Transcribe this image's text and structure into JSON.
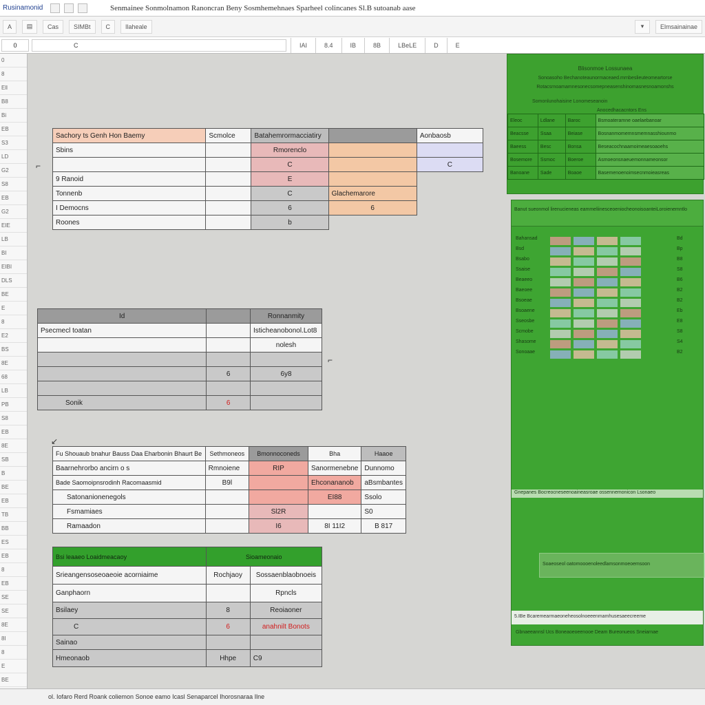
{
  "titlebar": {
    "app_name": "Rusinamonid",
    "title": "Senmainee  Sonmolnamon Ranoncran Beny  Sosmhemehnaes  Sparheel colincanes  Sl.B sutoanab aase"
  },
  "ribbon": {
    "items": [
      "A",
      "Cas",
      "SIMBt",
      "C",
      "Ilaheale"
    ],
    "right_label": "Elmsainainae"
  },
  "formula": {
    "name_box": "0",
    "fx_text": "C",
    "fx_hint": "0",
    "tabs": [
      "IAI",
      "8.4",
      "IB",
      "8B",
      "LBeLE",
      "D",
      "E"
    ]
  },
  "left_panel": {
    "rows": [
      "0",
      "8",
      "Ell",
      "B8",
      "Bi",
      "EB",
      "S3",
      "LD",
      "G2",
      "S8",
      "EB",
      "G2",
      "EIE",
      "LB",
      "BI",
      "EIBI",
      "DLS",
      "BE",
      "E",
      "8",
      "E2",
      "BS",
      "8E",
      "68",
      "LB",
      "PB",
      "S8",
      "EB",
      "8E",
      "SB",
      "B",
      "BE",
      "EB",
      "TB",
      "BB",
      "ES",
      "EB",
      "8",
      "EB",
      "SE",
      "SE",
      "8E",
      "8I",
      "8",
      "E",
      "BE"
    ]
  },
  "table1": {
    "header": [
      "Sachory ts Genh Hon Baemy",
      "Scmolce",
      "Batahemrormacciatiry",
      "",
      "Aonbaosb"
    ],
    "rows": [
      [
        "Sbins",
        "",
        "Rmorenclo",
        "",
        ""
      ],
      [
        "",
        "",
        "C",
        "",
        "C"
      ],
      [
        "9 Ranoid",
        "",
        "E",
        "",
        ""
      ],
      [
        "Tonnenb",
        "",
        "C",
        "Glachemarore",
        ""
      ],
      [
        "I Democns",
        "",
        "6",
        "6",
        ""
      ],
      [
        "Roones",
        "",
        "b",
        "",
        ""
      ]
    ]
  },
  "table2": {
    "header": [
      "Id",
      "",
      "Ronnanmity"
    ],
    "rows": [
      [
        "Psecmecl toatan",
        "",
        "Isticheanobonol.Lot8"
      ],
      [
        "",
        "",
        "nolesh"
      ],
      [
        "",
        "",
        ""
      ],
      [
        "",
        "6",
        "6y8"
      ],
      [
        "",
        "",
        ""
      ],
      [
        "Sonik",
        "6",
        ""
      ]
    ]
  },
  "table3": {
    "header": [
      "Fu Shouaub bnahur Bauss Daa Eharbonin Bhaurt Be",
      "Sethmoneos",
      "Bmonnoconeds",
      "Bha",
      "Haaoe"
    ],
    "rows": [
      [
        "Baarnehrorbo ancirn o s",
        "Rmnoiene",
        "RIP",
        "Sanormenebne",
        "Dunnomo"
      ],
      [
        "Bade Saomoipnsrodinh Racomaasmid",
        "B9l",
        "",
        "Ehconananob",
        "aBsmbantes"
      ],
      [
        "Satonanionenegols",
        "",
        "",
        "EI88",
        "Ssolo"
      ],
      [
        "Fsmamiaes",
        "",
        "Sl2R",
        "",
        "S0"
      ],
      [
        "Ramaadon",
        "",
        "I6",
        "8I 11I2",
        "B 817"
      ]
    ]
  },
  "table4": {
    "header": [
      "Bsi leaaeo Loaidmeacaoy",
      "Sioameonaio"
    ],
    "rows": [
      [
        "Srieangensoseoaeoie acorniaime",
        "Rochjaoy",
        "Sossaenblaobnoeis"
      ],
      [
        "Ganphaorn",
        "",
        "Rpncls"
      ],
      [
        "Bsilaey",
        "8",
        "Reoiaoner"
      ],
      [
        "C",
        "6",
        "anahnilt Bonots"
      ],
      [
        "Sainao",
        "",
        ""
      ],
      [
        "Hmeonaob",
        "Hhpe",
        "C9"
      ]
    ]
  },
  "green_panel": {
    "title": "Blisonmoe Lossunaea",
    "line1": "Sonoasoho  Bechanoteaunormaceaed.mrnbeslieuteomeartorse",
    "line2": "Rotacsrnoamamnesonecsomepneasenshinomasnesnoamonshs",
    "line3": "Somonlunohaisine  Lonomeseanoin",
    "line4": "Anocedhacacntors  Ens",
    "rows": [
      [
        "Eleoc",
        "Ldlane",
        "Baroc",
        "Bsmoateramne oaelaebanoar"
      ],
      [
        "Beacsse",
        "Ssaa",
        "Beiase",
        "Bosnanmomemnsmemnasshiounmo"
      ],
      [
        "Baeess",
        "Besc",
        "Bonsa",
        "Beseacochnaamoimeaesoaoehs"
      ],
      [
        "Bosemore",
        "Ssmoc",
        "Boeroe",
        "Asmoeonsnaeuemonnameonsor"
      ],
      [
        "Banoane",
        "Sade",
        "Boaoe",
        "Basemenoenoimsecnmoieasreas"
      ]
    ]
  },
  "green_panel2": {
    "header": "Banut sueonmol lirenucieneas  eammeliinesceoeniocheonoisoanteiLoroienemntlo",
    "rows": [
      {
        "label": "Bahansad",
        "v": "Bd"
      },
      {
        "label": "Bsd",
        "v": "Bp"
      },
      {
        "label": "Bsabo",
        "v": "B8"
      },
      {
        "label": "Ssaise",
        "v": "S8"
      },
      {
        "label": "Beaeeo",
        "v": "B6"
      },
      {
        "label": "Baeoee",
        "v": "B2"
      },
      {
        "label": "Bsoeae",
        "v": "B2"
      },
      {
        "label": "Bsoaene",
        "v": "Eb"
      },
      {
        "label": "Sseosbe",
        "v": "E8"
      },
      {
        "label": "Scmobe",
        "v": "S8"
      },
      {
        "label": "Shasome",
        "v": "S4"
      },
      {
        "label": "Sonoaae",
        "v": "B2"
      }
    ],
    "foot_band": "Gnepanes Bocreocneseenoaineasroae ossennemonicon Lsonaeo",
    "note": "Soaeoseol oatomoooenoleedlamsonmoeoemsoon",
    "footer": "5.IBe  Bcaremearmaeoneheosolnoeeenmamhusesaeecreeme",
    "footer2": "Gbnaeeannsl Ucs Boneaoeoeenooe Deam Bureonueos Sneiarnae"
  },
  "status": {
    "text": "ol. Iofaro  Rerd Roank  coliemon  Sonoe eamo Icasl   Senaparcel Ihorosnaraa Ilne"
  },
  "colors": {
    "accent_green": "#3da12f",
    "peach": "#f6ceb9",
    "salmon": "#f1a9a0",
    "lavender": "#dcdcf3"
  }
}
